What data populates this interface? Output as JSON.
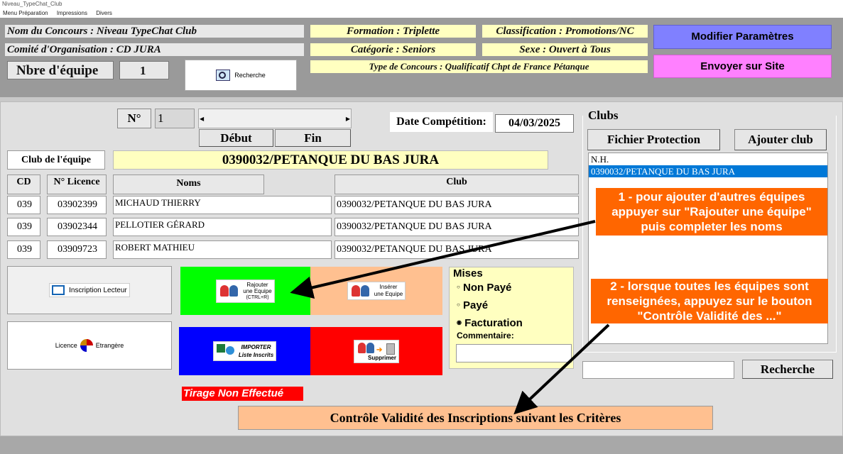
{
  "window": {
    "title": "Niveau_TypeChat_Club"
  },
  "menu": [
    "Menu Préparation",
    "Impressions",
    "Divers"
  ],
  "header": {
    "nom_concours": "Nom du Concours : Niveau  TypeChat  Club",
    "comite": "Comité d'Organisation : CD JURA",
    "nbre_label": "Nbre d'équipe",
    "nbre_value": "1",
    "recherche_label": "Recherche",
    "formation": "Formation : Triplette",
    "categorie": "Catégorie : Seniors",
    "type_concours": "Type de Concours : Qualificatif Chpt de France Pétanque",
    "classification": "Classification : Promotions/NC",
    "sexe": "Sexe : Ouvert à Tous",
    "modifier_btn": "Modifier Paramètres",
    "envoyer_btn": "Envoyer sur Site"
  },
  "nav": {
    "num_label": "N°",
    "num_value": "1",
    "debut_btn": "Début",
    "fin_btn": "Fin",
    "date_label": "Date Compétition:",
    "date_value": "04/03/2025"
  },
  "team": {
    "club_label": "Club de l'équipe",
    "club_value": "0390032/PETANQUE DU BAS JURA",
    "columns": {
      "cd": "CD",
      "licence": "N° Licence",
      "noms": "Noms",
      "club": "Club"
    },
    "rows": [
      {
        "cd": "039",
        "licence": "03902399",
        "nom": "MICHAUD THIERRY",
        "club": "0390032/PETANQUE DU BAS JURA"
      },
      {
        "cd": "039",
        "licence": "03902344",
        "nom": "PELLOTIER GÉRARD",
        "club": "0390032/PETANQUE DU BAS JURA"
      },
      {
        "cd": "039",
        "licence": "03909723",
        "nom": "ROBERT MATHIEU",
        "club": "0390032/PETANQUE DU BAS JURA"
      }
    ]
  },
  "actions": {
    "inscription_lecteur": "Inscription Lecteur",
    "licence": "Licence",
    "etrangere": "Etrangère",
    "rajouter_line1": "Rajouter",
    "rajouter_line2": "une Equipe",
    "rajouter_line3": "(CTRL+R)",
    "inserer_line1": "Insérer",
    "inserer_line2": "une Equipe",
    "importer_line1": "IMPORTER",
    "importer_line2": "Liste Inscrits",
    "supprimer": "Supprimer",
    "tirage": "Tirage Non Effectué",
    "controle": "Contrôle Validité des Inscriptions suivant les Critères"
  },
  "mises": {
    "title": "Mises",
    "options": [
      "Non Payé",
      "Payé",
      "Facturation"
    ],
    "selected": "Facturation",
    "commentaire_label": "Commentaire:"
  },
  "clubs": {
    "title": "Clubs",
    "fichier_btn": "Fichier Protection",
    "ajouter_btn": "Ajouter club",
    "list": [
      "N.H.",
      "0390032/PETANQUE DU BAS JURA"
    ],
    "selected": "0390032/PETANQUE DU BAS JURA",
    "recherche_btn": "Recherche"
  },
  "callouts": {
    "one_l1": "1 - pour ajouter d'autres équipes",
    "one_l2": "appuyer sur \"Rajouter une équipe\"",
    "one_l3": "puis completer les noms",
    "two_l1": "2 - lorsque toutes les équipes sont",
    "two_l2": "renseignées, appuyez sur le bouton",
    "two_l3": "\"Contrôle Validité des ...\""
  },
  "colors": {
    "green": "#00ff00",
    "peach": "#ffc090",
    "blue": "#0000ff",
    "red": "#ff0000",
    "orange": "#ff6600",
    "selected_blue": "#0078d7"
  }
}
